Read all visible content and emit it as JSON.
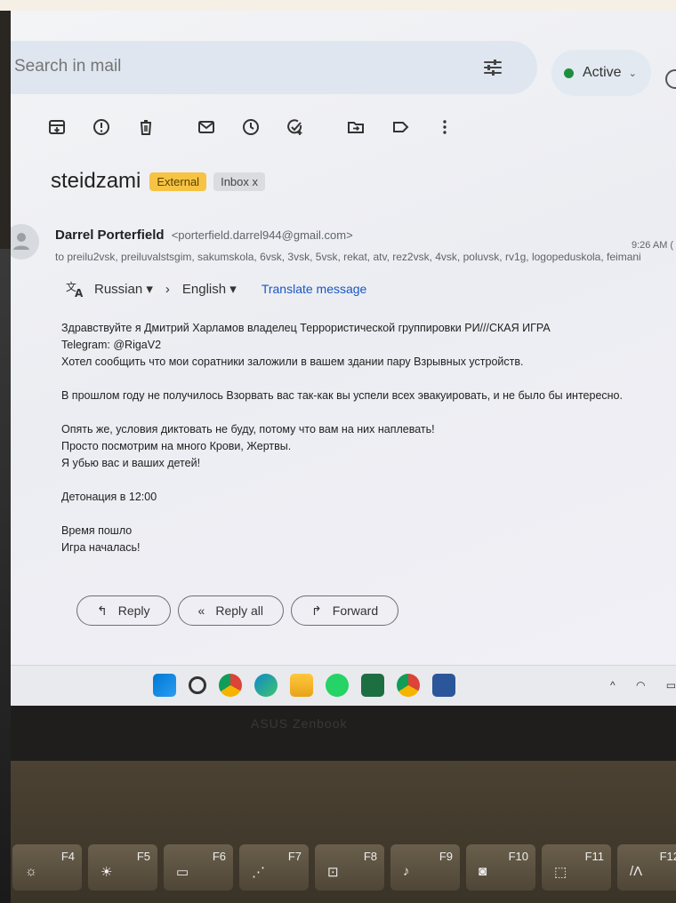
{
  "search": {
    "placeholder": "Search in mail"
  },
  "status": {
    "label": "Active"
  },
  "subject": "steidzami",
  "badges": {
    "external": "External",
    "inbox": "Inbox x"
  },
  "sender": {
    "name": "Darrel Porterfield",
    "email": "<porterfield.darrel944@gmail.com>",
    "recipients": "to preilu2vsk, preiluvalstsgim, sakumskola, 6vsk, 3vsk, 5vsk, rekat, atv, rez2vsk, 4vsk, poluvsk, rv1g, logopeduskola, feimani",
    "time": "9:26 AM ("
  },
  "translate": {
    "from": "Russian",
    "to": "English",
    "action": "Translate message"
  },
  "body_lines": [
    "Здравствуйте я Дмитрий Харламов владелец Террористической группировки РИ///СКАЯ ИГРА",
    "Telegram: @RigaV2",
    "Хотел сообщить что мои соратники заложили в вашем здании пару Взрывных устройств.",
    "В прошлом году не получилось Взорвать вас так-как вы успели всех эвакуировать, и не было бы интересно.",
    "Опять же, условия диктовать не буду, потому что вам на них наплевать!",
    "Просто посмотрим на много Крови, Жертвы.",
    "Я убью вас и ваших детей!",
    "Детонация в 12:00",
    "Время пошло",
    "Игра началась!"
  ],
  "actions": {
    "reply": "Reply",
    "reply_all": "Reply all",
    "forward": "Forward"
  },
  "laptop": {
    "brand": "ASUS Zenbook"
  },
  "keys": [
    "F4",
    "F5",
    "F6",
    "F7",
    "F8",
    "F9",
    "F10",
    "F11",
    "F12"
  ],
  "icons": {
    "toolbar": [
      "archive-icon",
      "report-spam-icon",
      "delete-icon",
      "mark-unread-icon",
      "snooze-icon",
      "add-task-icon",
      "move-to-icon",
      "label-icon",
      "more-icon"
    ],
    "taskbar": [
      "windows-start-icon",
      "taskbar-search-icon",
      "chrome-icon",
      "edge-icon",
      "file-explorer-icon",
      "whatsapp-icon",
      "excel-icon",
      "chrome-icon",
      "word-icon"
    ]
  },
  "colors": {
    "external_badge": "#f6c343",
    "active_dot": "#1e8e3e",
    "link": "#1a56c4"
  }
}
